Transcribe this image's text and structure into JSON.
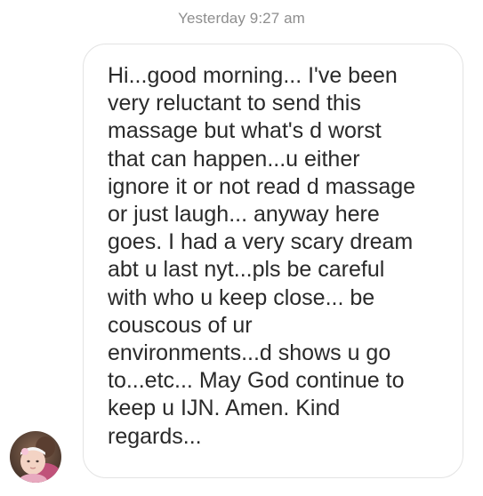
{
  "thread": {
    "timestamp": "Yesterday 9:27 am"
  },
  "message": {
    "text": "Hi...good morning... I've been\nvery reluctant to send this\nmassage but what's d worst\nthat can happen...u either\nignore it or not read d massage\nor just laugh... anyway here\ngoes. I had a very scary dream\nabt u last nyt...pls be careful\nwith who u keep close... be\ncouscous of ur\nenvironments...d shows u go\nto...etc... May God continue to\nkeep u IJN. Amen. Kind\nregards..."
  },
  "sender": {
    "avatar_icon": "profile-photo"
  }
}
